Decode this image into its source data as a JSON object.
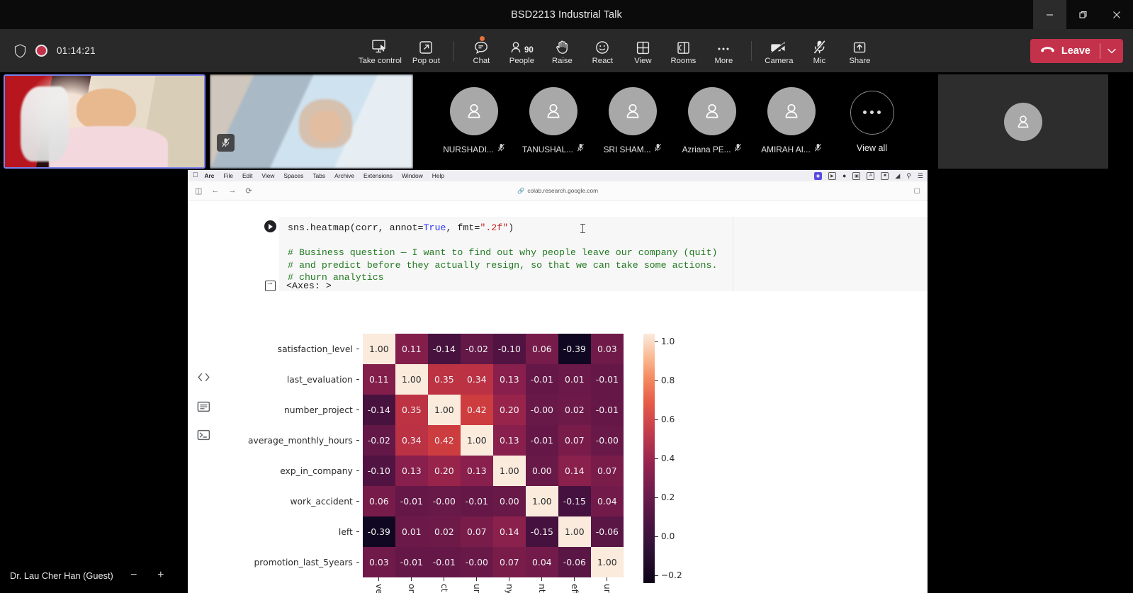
{
  "window": {
    "title": "BSD2213 Industrial Talk",
    "controls": [
      {
        "name": "minimize",
        "glyph": "minimize"
      },
      {
        "name": "restore",
        "glyph": "restore"
      },
      {
        "name": "close",
        "glyph": "close"
      }
    ]
  },
  "commandbar": {
    "shield_icon": "shield-icon",
    "record_icon": "record-dot-icon",
    "recording_time": "01:14:21",
    "buttons": [
      {
        "label": "Take control",
        "icon": "take-control-icon",
        "badge": null,
        "count": null
      },
      {
        "label": "Pop out",
        "icon": "pop-out-icon",
        "badge": null,
        "count": null
      },
      {
        "label": "Chat",
        "icon": "chat-icon",
        "badge": "unread",
        "count": null
      },
      {
        "label": "People",
        "icon": "people-icon",
        "badge": null,
        "count": "90"
      },
      {
        "label": "Raise",
        "icon": "raise-hand-icon",
        "badge": null,
        "count": null
      },
      {
        "label": "React",
        "icon": "react-smiley-icon",
        "badge": null,
        "count": null
      },
      {
        "label": "View",
        "icon": "view-grid-icon",
        "badge": null,
        "count": null
      },
      {
        "label": "Rooms",
        "icon": "breakout-rooms-icon",
        "badge": null,
        "count": null
      },
      {
        "label": "More",
        "icon": "more-ellipsis-icon",
        "badge": null,
        "count": null
      }
    ],
    "right_buttons": [
      {
        "label": "Camera",
        "icon": "camera-off-icon",
        "state": "off"
      },
      {
        "label": "Mic",
        "icon": "mic-off-icon",
        "state": "off"
      },
      {
        "label": "Share",
        "icon": "share-up-arrow-icon",
        "state": "on"
      }
    ],
    "leave_label": "Leave",
    "leave_color": "#c4314b"
  },
  "participants": {
    "video_tiles": [
      {
        "name": "active-speaker-video",
        "muted": false,
        "highlighted": true
      },
      {
        "name": "second-video",
        "muted": true,
        "highlighted": false
      }
    ],
    "avatars": [
      {
        "label": "NURSHADI...",
        "muted": true
      },
      {
        "label": "TANUSHAL...",
        "muted": true
      },
      {
        "label": "SRI SHAM...",
        "muted": true
      },
      {
        "label": "Azriana PE...",
        "muted": true
      },
      {
        "label": "AMIRAH AI...",
        "muted": true
      }
    ],
    "view_all_label": "View all",
    "overflow_tile": "participant-placeholder"
  },
  "shared_screen": {
    "mac_menubar": {
      "apple": "",
      "items": [
        "Arc",
        "File",
        "Edit",
        "View",
        "Spaces",
        "Tabs",
        "Archive",
        "Extensions",
        "Window",
        "Help"
      ],
      "status_icons": [
        "screen-share-icon",
        "camera-icon",
        "bell-icon",
        "display-icon",
        "input-source-icon",
        "battery-icon",
        "wifi-icon",
        "spotlight-search-icon",
        "control-center-icon"
      ]
    },
    "browser": {
      "sidebar_toggle_icon": "sidebar-toggle-icon",
      "back_icon": "back-arrow-icon",
      "forward_icon": "forward-arrow-icon",
      "reload_icon": "reload-icon",
      "url": "colab.research.google.com",
      "url_lock_icon": "link-icon",
      "right_icon": "extension-icon"
    },
    "colab": {
      "rail_icons": [
        "code-snippets-icon",
        "notes-icon",
        "terminal-icon"
      ],
      "run_button": "run-cell-button",
      "code_lines": [
        {
          "segments": [
            {
              "t": "sns.heatmap(corr, annot=",
              "c": "plain"
            },
            {
              "t": "True",
              "c": "bool"
            },
            {
              "t": ", fmt=",
              "c": "plain"
            },
            {
              "t": "\".2f\"",
              "c": "str"
            },
            {
              "t": ")",
              "c": "plain"
            }
          ]
        },
        {
          "segments": [
            {
              "t": "",
              "c": "plain"
            }
          ]
        },
        {
          "segments": [
            {
              "t": "# Business question — I want to find out why people leave our company (quit)",
              "c": "com"
            }
          ]
        },
        {
          "segments": [
            {
              "t": "# and predict before they actually resign, so that we can take some actions.",
              "c": "com"
            }
          ]
        },
        {
          "segments": [
            {
              "t": "# churn analytics",
              "c": "com"
            }
          ]
        }
      ],
      "output_icon": "output-icon",
      "output_text": "<Axes: >"
    }
  },
  "chart_data": {
    "type": "heatmap",
    "title": "",
    "xlabel": "",
    "ylabel": "",
    "annot": true,
    "fmt": ".2f",
    "colormap": "rocket",
    "colorbar": {
      "ticks": [
        1.0,
        0.8,
        0.6,
        0.4,
        0.2,
        0.0,
        -0.2
      ],
      "tick_labels": [
        "1.0",
        "0.8",
        "0.6",
        "0.4",
        "0.2",
        "0.0",
        "−0.2"
      ],
      "vmin": -0.39,
      "vmax": 1.0,
      "range_shown": [
        -0.2,
        1.0
      ]
    },
    "categories": [
      "satisfaction_level",
      "last_evaluation",
      "number_project",
      "average_monthly_hours",
      "exp_in_company",
      "work_accident",
      "left",
      "promotion_last_5years"
    ],
    "x_tick_labels_visible": [
      "vel",
      "on",
      "ct",
      "urs",
      "ny",
      "nt",
      "eft",
      "urs"
    ],
    "rows": [
      {
        "label": "satisfaction_level",
        "values": [
          "1.00",
          "0.11",
          "-0.14",
          "-0.02",
          "-0.10",
          "0.06",
          "-0.39",
          "0.03"
        ]
      },
      {
        "label": "last_evaluation",
        "values": [
          "0.11",
          "1.00",
          "0.35",
          "0.34",
          "0.13",
          "-0.01",
          "0.01",
          "-0.01"
        ]
      },
      {
        "label": "number_project",
        "values": [
          "-0.14",
          "0.35",
          "1.00",
          "0.42",
          "0.20",
          "-0.00",
          "0.02",
          "-0.01"
        ]
      },
      {
        "label": "average_monthly_hours",
        "values": [
          "-0.02",
          "0.34",
          "0.42",
          "1.00",
          "0.13",
          "-0.01",
          "0.07",
          "-0.00"
        ]
      },
      {
        "label": "exp_in_company",
        "values": [
          "-0.10",
          "0.13",
          "0.20",
          "0.13",
          "1.00",
          "0.00",
          "0.14",
          "0.07"
        ]
      },
      {
        "label": "work_accident",
        "values": [
          "0.06",
          "-0.01",
          "-0.00",
          "-0.01",
          "0.00",
          "1.00",
          "-0.15",
          "0.04"
        ]
      },
      {
        "label": "left",
        "values": [
          "-0.39",
          "0.01",
          "0.02",
          "0.07",
          "0.14",
          "-0.15",
          "1.00",
          "-0.06"
        ]
      },
      {
        "label": "promotion_last_5years",
        "values": [
          "0.03",
          "-0.01",
          "-0.01",
          "-0.00",
          "0.07",
          "0.04",
          "-0.06",
          "1.00"
        ]
      }
    ],
    "numeric": [
      [
        1.0,
        0.11,
        -0.14,
        -0.02,
        -0.1,
        0.06,
        -0.39,
        0.03
      ],
      [
        0.11,
        1.0,
        0.35,
        0.34,
        0.13,
        -0.01,
        0.01,
        -0.01
      ],
      [
        -0.14,
        0.35,
        1.0,
        0.42,
        0.2,
        -0.0,
        0.02,
        -0.01
      ],
      [
        -0.02,
        0.34,
        0.42,
        1.0,
        0.13,
        -0.01,
        0.07,
        -0.0
      ],
      [
        -0.1,
        0.13,
        0.2,
        0.13,
        1.0,
        0.0,
        0.14,
        0.07
      ],
      [
        0.06,
        -0.01,
        -0.0,
        -0.01,
        0.0,
        1.0,
        -0.15,
        0.04
      ],
      [
        -0.39,
        0.01,
        0.02,
        0.07,
        0.14,
        -0.15,
        1.0,
        -0.06
      ],
      [
        0.03,
        -0.01,
        -0.01,
        -0.0,
        0.07,
        0.04,
        -0.06,
        1.0
      ]
    ]
  },
  "footer": {
    "participant_name": "Dr. Lau Cher Han (Guest)",
    "zoom_out": "−",
    "zoom_in": "+"
  }
}
